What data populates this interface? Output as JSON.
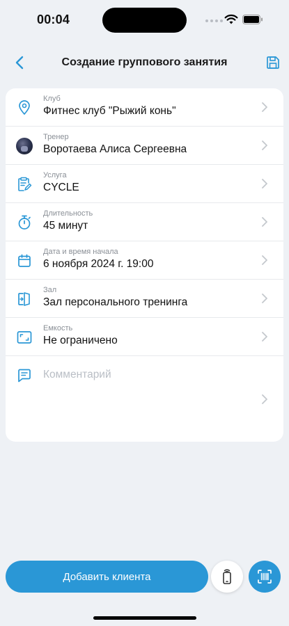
{
  "status_bar": {
    "time": "00:04"
  },
  "nav": {
    "title": "Создание группового занятия"
  },
  "form": {
    "rows": [
      {
        "label": "Клуб",
        "value": "Фитнес клуб \"Рыжий конь\"",
        "icon": "location-pin-icon"
      },
      {
        "label": "Тренер",
        "value": "Воротаева Алиса Сергеевна",
        "icon": "trainer-avatar"
      },
      {
        "label": "Услуга",
        "value": "CYCLE",
        "icon": "clipboard-edit-icon"
      },
      {
        "label": "Длительность",
        "value": "45 минут",
        "icon": "stopwatch-icon"
      },
      {
        "label": "Дата и время начала",
        "value": "6 ноября 2024 г. 19:00",
        "icon": "calendar-icon"
      },
      {
        "label": "Зал",
        "value": "Зал персонального тренинга",
        "icon": "door-enter-icon"
      },
      {
        "label": "Емкость",
        "value": "Не ограничено",
        "icon": "capacity-frame-icon"
      }
    ],
    "comment": {
      "placeholder": "Комментарий",
      "icon": "chat-bubble-icon"
    }
  },
  "actions": {
    "add_client_label": "Добавить клиента"
  },
  "colors": {
    "accent": "#2a97d6",
    "background": "#eef1f5"
  }
}
